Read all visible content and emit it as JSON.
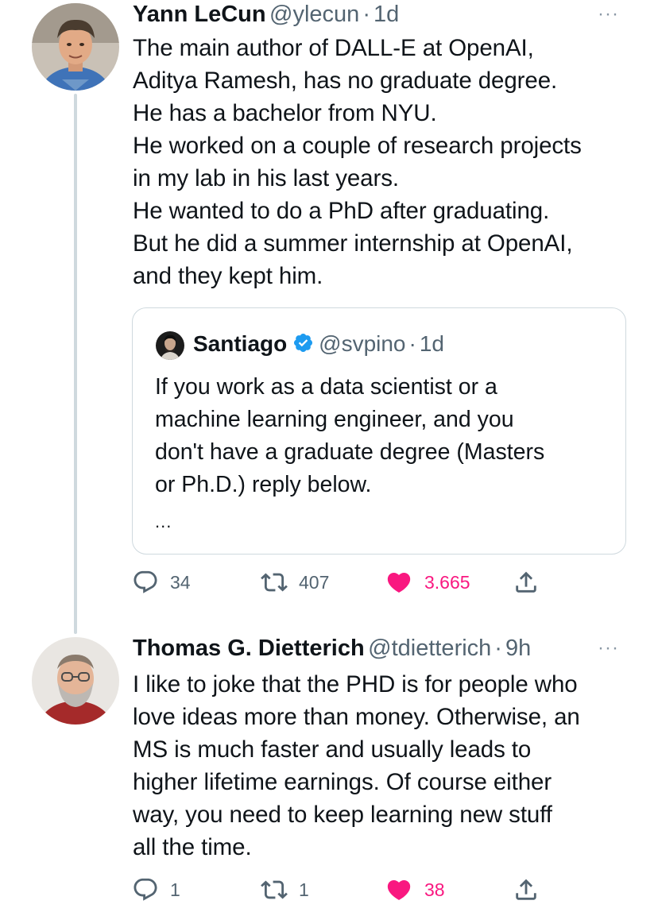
{
  "tweet1": {
    "author_name": "Yann LeCun",
    "handle": "@ylecun",
    "separator": "·",
    "time": "1d",
    "more_label": "···",
    "text": "The main author of DALL-E at OpenAI,\nAditya Ramesh, has no graduate degree.\nHe has a bachelor from NYU.\nHe worked on a couple of research projects\nin my lab in his last years.\nHe wanted to do a PhD after graduating.\nBut he did a summer internship at OpenAI,\nand they kept him.",
    "quote": {
      "author_name": "Santiago",
      "handle": "@svpino",
      "separator": "·",
      "time": "1d",
      "text": "If you work as a data scientist or a\nmachine learning engineer, and you\ndon't have a graduate degree (Masters\nor Ph.D.) reply below.",
      "ellipsis": "..."
    },
    "actions": {
      "replies": "34",
      "retweets": "407",
      "likes": "3.665"
    }
  },
  "tweet2": {
    "author_name": "Thomas G. Dietterich",
    "handle": "@tdietterich",
    "separator": "·",
    "time": "9h",
    "more_label": "···",
    "text": "I like to joke that the PHD is for people who\nlove ideas more than money. Otherwise, an\nMS is much faster and usually leads to\nhigher lifetime earnings. Of course either\nway, you need to keep learning new stuff\nall the time.",
    "actions": {
      "replies": "1",
      "retweets": "1",
      "likes": "38"
    }
  },
  "colors": {
    "text": "#0f1419",
    "secondary": "#536471",
    "like": "#f91880",
    "verified": "#1d9bf0",
    "border": "#cfd9de"
  },
  "icons": [
    "reply-icon",
    "retweet-icon",
    "heart-icon",
    "share-icon",
    "verified-badge-icon",
    "more-icon"
  ]
}
